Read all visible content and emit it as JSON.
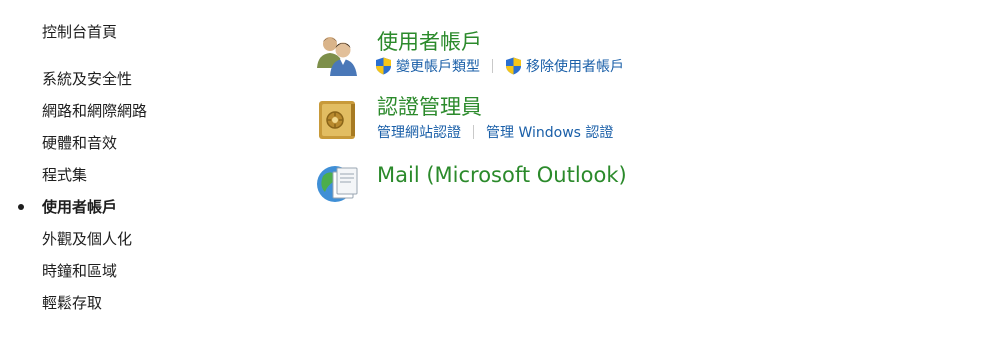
{
  "nav": {
    "home": "控制台首頁",
    "items": [
      "系統及安全性",
      "網路和網際網路",
      "硬體和音效",
      "程式集",
      "使用者帳戶",
      "外觀及個人化",
      "時鐘和區域",
      "輕鬆存取"
    ],
    "current_index": 4
  },
  "groups": {
    "user_accounts": {
      "title": "使用者帳戶",
      "icon": "users-icon",
      "links": [
        "變更帳戶類型",
        "移除使用者帳戶"
      ],
      "link_icon": "uac-shield-icon"
    },
    "credential_manager": {
      "title": "認證管理員",
      "icon": "vault-icon",
      "links": [
        "管理網站認證",
        "管理 Windows 認證"
      ]
    },
    "mail": {
      "title": "Mail (Microsoft Outlook)",
      "icon": "mail-globe-icon"
    }
  },
  "colors": {
    "title_green": "#2b8a2b",
    "link_blue": "#1a5fa8",
    "nav_text": "#1e1e1e"
  }
}
